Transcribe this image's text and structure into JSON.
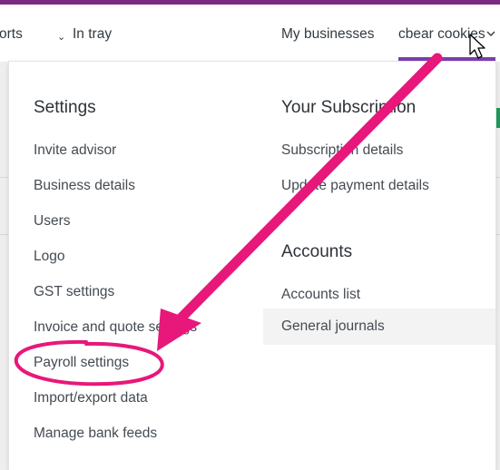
{
  "nav": {
    "reports_partial": "orts",
    "in_tray": "In tray",
    "my_businesses": "My businesses",
    "business_name": "cbear cookies",
    "chevron_icon": "chevron-down-icon"
  },
  "settings": {
    "heading": "Settings",
    "items": [
      "Invite advisor",
      "Business details",
      "Users",
      "Logo",
      "GST settings",
      "Invoice and quote settings",
      "Payroll settings",
      "Import/export data",
      "Manage bank feeds"
    ]
  },
  "subscription": {
    "heading": "Your Subscription",
    "items": [
      "Subscription details",
      "Update payment details"
    ]
  },
  "accounts": {
    "heading": "Accounts",
    "items": [
      "Accounts list",
      "General journals"
    ]
  },
  "colors": {
    "accent_purple": "#7b2a84",
    "active_underline": "#7b3fb1",
    "annotation_pink": "#e8177a"
  }
}
